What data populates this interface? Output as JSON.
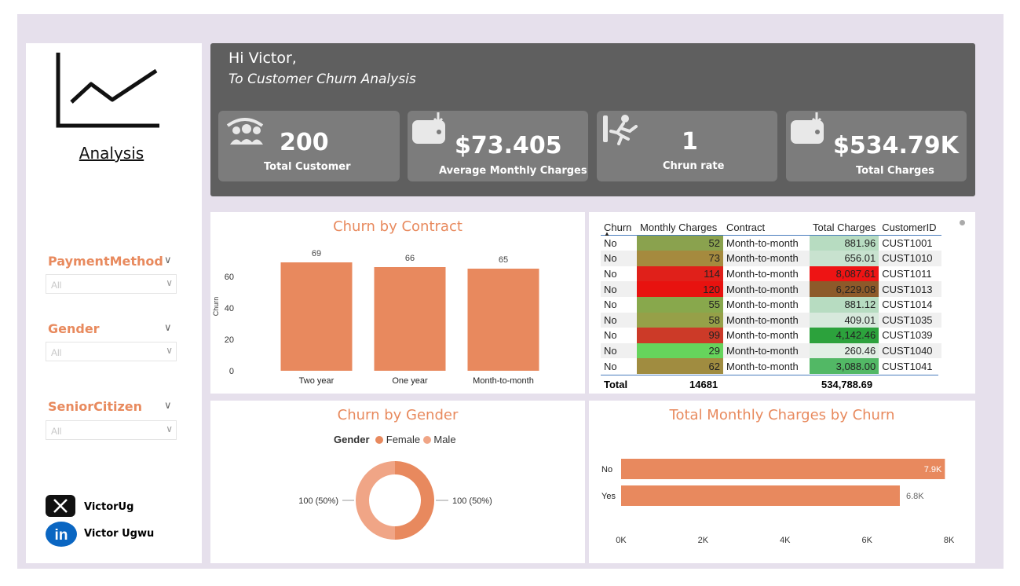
{
  "sidebar": {
    "title": "Analysis",
    "filters": [
      {
        "label": "PaymentMethod",
        "value": "All"
      },
      {
        "label": "Gender",
        "value": "All"
      },
      {
        "label": "SeniorCitizen",
        "value": "All"
      }
    ],
    "social": [
      {
        "icon": "x-twitter-icon",
        "label": "VictorUg"
      },
      {
        "icon": "linkedin-icon",
        "label": "Victor Ugwu"
      }
    ]
  },
  "header": {
    "greeting": "Hi Victor,",
    "subtitle": "To Customer Churn Analysis",
    "kpis": [
      {
        "icon": "customers-icon",
        "value": "200",
        "label": "Total Customer"
      },
      {
        "icon": "wallet-download-icon",
        "value": "$73.405",
        "label": "Average Monthly Charges"
      },
      {
        "icon": "running-person-icon",
        "value": "1",
        "label": "Chrun rate"
      },
      {
        "icon": "wallet-download-icon",
        "value": "$534.79K",
        "label": "Total Charges"
      }
    ]
  },
  "contract_chart": {
    "title": "Churn by Contract",
    "ylabel": "Churn",
    "yticks": [
      "0",
      "20",
      "40",
      "60"
    ],
    "bar_color": "#e8895e"
  },
  "gender_chart": {
    "title": "Churn by Gender",
    "legend_title": "Gender",
    "legend": [
      {
        "label": "Female",
        "color": "#e8895e"
      },
      {
        "label": "Male",
        "color": "#f0a586"
      }
    ],
    "left_label": "100 (50%)",
    "right_label": "100 (50%)"
  },
  "monthly_chart": {
    "title": "Total Monthly Charges by Churn",
    "xticks": [
      "0K",
      "2K",
      "4K",
      "6K",
      "8K"
    ]
  },
  "table": {
    "columns": [
      "Churn",
      "Monthly Charges",
      "Contract",
      "Total Charges",
      "CustomerID"
    ],
    "rows": [
      {
        "churn": "No",
        "monthly": "52",
        "contract": "Month-to-month",
        "total": "881.96",
        "id": "CUST1001",
        "mc": "#8aa24e",
        "tc": "#b7dcc1"
      },
      {
        "churn": "No",
        "monthly": "73",
        "contract": "Month-to-month",
        "total": "656.01",
        "id": "CUST1010",
        "mc": "#a58a3e",
        "tc": "#c8e2cf"
      },
      {
        "churn": "No",
        "monthly": "114",
        "contract": "Month-to-month",
        "total": "8,087.61",
        "id": "CUST1011",
        "mc": "#e0201a",
        "tc": "#ee1414"
      },
      {
        "churn": "No",
        "monthly": "120",
        "contract": "Month-to-month",
        "total": "6,229.08",
        "id": "CUST1013",
        "mc": "#e8120f",
        "tc": "#8d5a2a"
      },
      {
        "churn": "No",
        "monthly": "55",
        "contract": "Month-to-month",
        "total": "881.12",
        "id": "CUST1014",
        "mc": "#88a84c",
        "tc": "#b7dcc1"
      },
      {
        "churn": "No",
        "monthly": "58",
        "contract": "Month-to-month",
        "total": "409.01",
        "id": "CUST1035",
        "mc": "#96a048",
        "tc": "#d7e9dc"
      },
      {
        "churn": "No",
        "monthly": "99",
        "contract": "Month-to-month",
        "total": "4,142.46",
        "id": "CUST1039",
        "mc": "#cc3a28",
        "tc": "#2ca23c"
      },
      {
        "churn": "No",
        "monthly": "29",
        "contract": "Month-to-month",
        "total": "260.46",
        "id": "CUST1040",
        "mc": "#66d45c",
        "tc": "#e2efe5"
      },
      {
        "churn": "No",
        "monthly": "62",
        "contract": "Month-to-month",
        "total": "3,088.00",
        "id": "CUST1041",
        "mc": "#a08c40",
        "tc": "#52b865"
      }
    ],
    "total": {
      "label": "Total",
      "monthly": "14681",
      "total": "534,788.69"
    }
  },
  "chart_data": [
    {
      "type": "bar",
      "title": "Churn by Contract",
      "categories": [
        "Two year",
        "One year",
        "Month-to-month"
      ],
      "values": [
        69,
        66,
        65
      ],
      "ylabel": "Churn",
      "ylim": [
        0,
        75
      ]
    },
    {
      "type": "pie",
      "title": "Churn by Gender",
      "categories": [
        "Female",
        "Male"
      ],
      "values": [
        100,
        100
      ]
    },
    {
      "type": "bar",
      "title": "Total Monthly Charges by Churn",
      "categories": [
        "No",
        "Yes"
      ],
      "values": [
        7.9,
        6.8
      ],
      "value_labels": [
        "7.9K",
        "6.8K"
      ],
      "xlim": [
        0,
        8
      ]
    }
  ]
}
